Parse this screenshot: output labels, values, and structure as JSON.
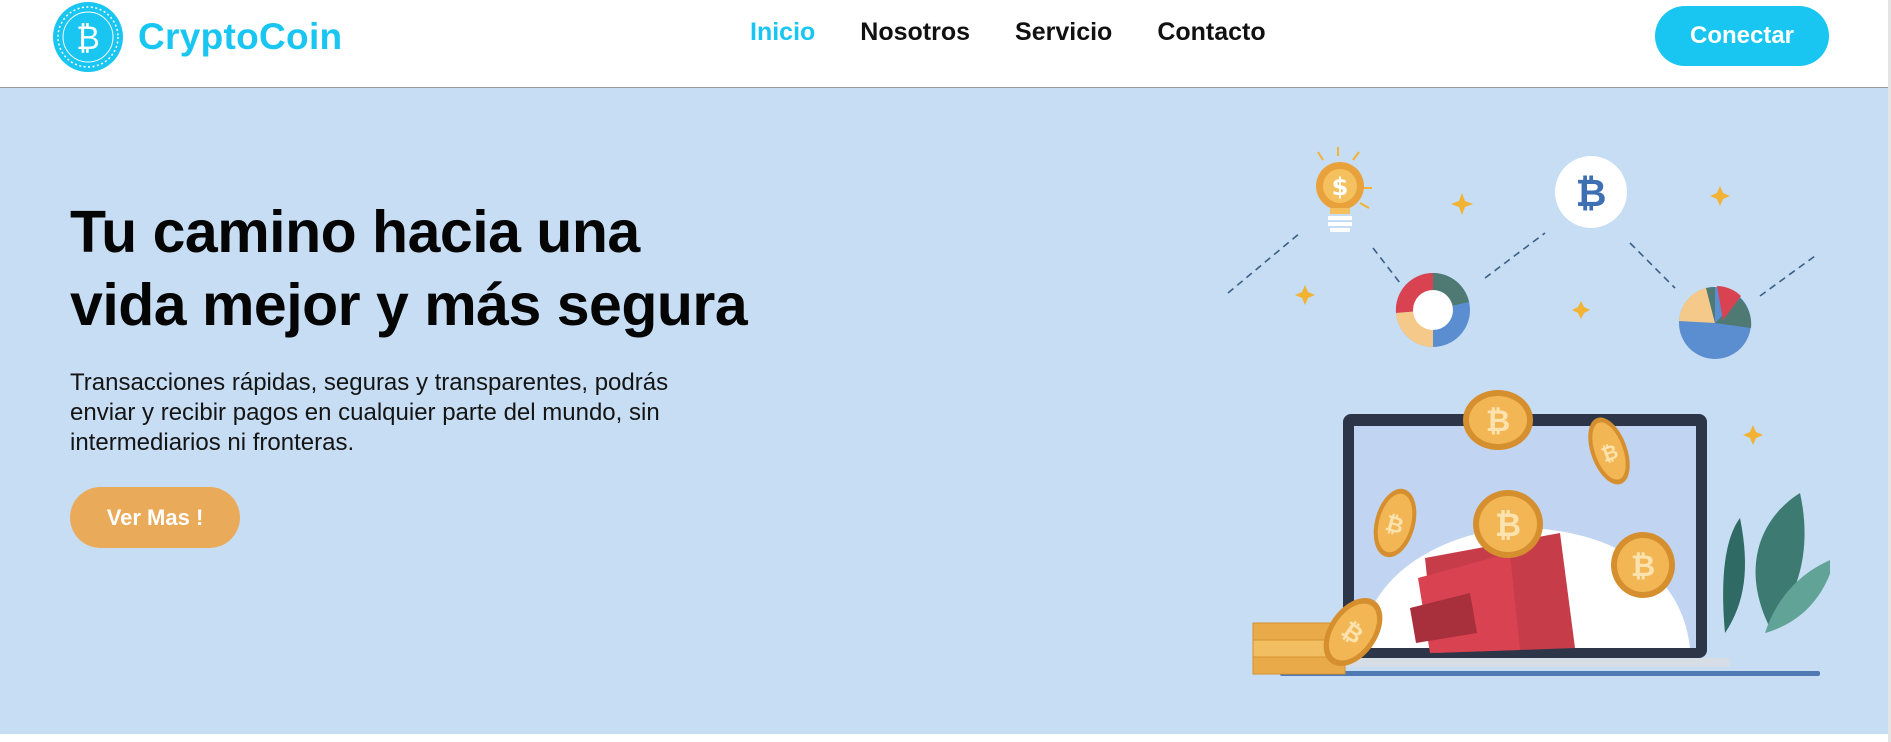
{
  "brand": {
    "name": "CryptoCoin",
    "logo_icon": "bitcoin-logo-icon",
    "color": "#19c6f2"
  },
  "nav": {
    "items": [
      {
        "label": "Inicio",
        "active": true
      },
      {
        "label": "Nosotros",
        "active": false
      },
      {
        "label": "Servicio",
        "active": false
      },
      {
        "label": "Contacto",
        "active": false
      }
    ]
  },
  "header": {
    "connect_label": "Conectar"
  },
  "hero": {
    "title_line1": "Tu camino hacia una",
    "title_line2": "vida mejor y más segura",
    "description": "Transacciones rápidas, seguras y transparentes, podrás enviar y recibir pagos en cualquier parte del mundo, sin intermediarios ni fronteras.",
    "cta_label": "Ver Mas !",
    "background": "#c6ddf3",
    "cta_color": "#e9ab5a"
  },
  "illustration": {
    "icons": [
      "lightbulb-dollar-icon",
      "bitcoin-circle-icon",
      "donut-chart-icon",
      "pie-chart-icon",
      "laptop-icon",
      "wallet-icon",
      "bitcoin-coin-icon",
      "sparkle-icon",
      "leaf-icon"
    ],
    "coin_symbol": "₿",
    "dollar_symbol": "$"
  }
}
